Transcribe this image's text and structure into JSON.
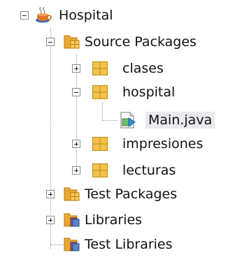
{
  "tree": {
    "project": "Hospital",
    "source_packages": "Source Packages",
    "packages": {
      "clases": "clases",
      "hospital": "hospital",
      "impresiones": "impresiones",
      "lecturas": "lecturas"
    },
    "main_file": "Main.java",
    "test_packages": "Test Packages",
    "libraries": "Libraries",
    "test_libraries": "Test Libraries"
  }
}
